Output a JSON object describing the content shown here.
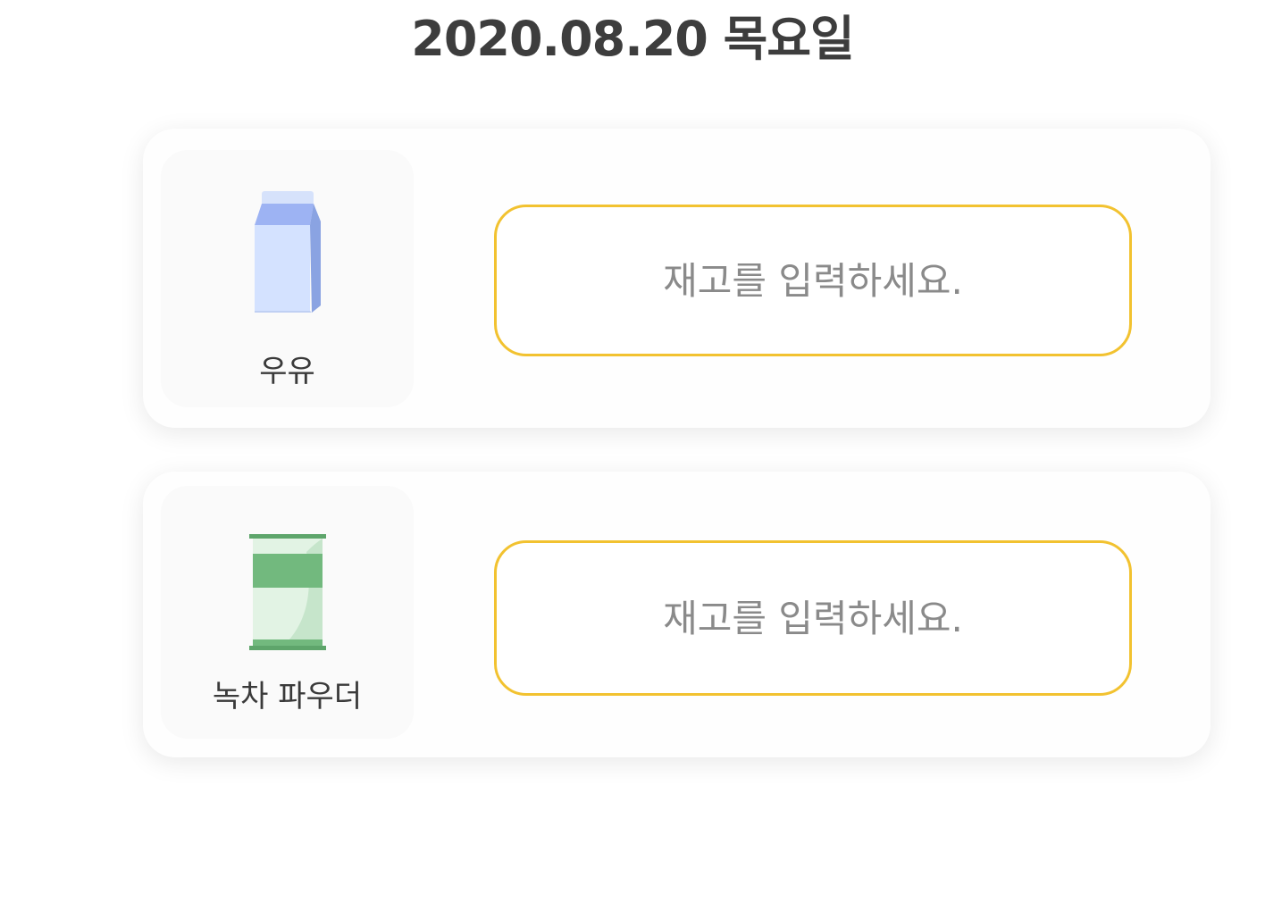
{
  "header": {
    "date": "2020.08.20 목요일"
  },
  "items": [
    {
      "name": "우유",
      "icon": "milk-carton-icon",
      "input_placeholder": "재고를 입력하세요.",
      "input_value": ""
    },
    {
      "name": "녹차 파우더",
      "icon": "green-tea-powder-bag-icon",
      "input_placeholder": "재고를 입력하세요.",
      "input_value": ""
    }
  ],
  "colors": {
    "input_border": "#f2c230",
    "placeholder": "#8a8a8a",
    "title": "#3d3d3d",
    "milk_carton": "#d4e2ff",
    "milk_carton_dark": "#9ab1f0",
    "tea_bag_green": "#72b97e",
    "tea_bag_light": "#e2f3e4"
  }
}
